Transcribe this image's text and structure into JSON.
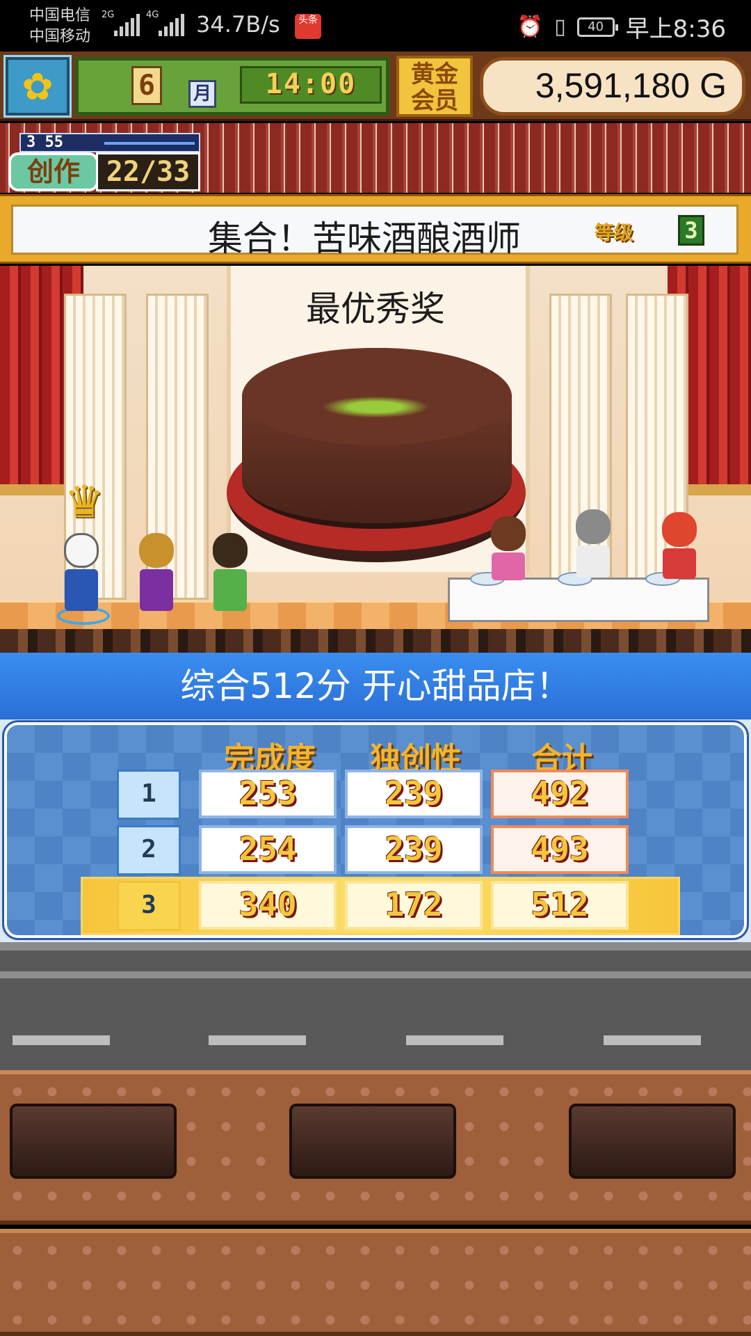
{
  "status_bar": {
    "carrier1": "中国电信",
    "carrier2": "中国移动",
    "net1": "2G",
    "net2": "4G",
    "speed": "34.7B/s",
    "app_icon": "头条",
    "battery": "40",
    "time": "早上8:36",
    "icons": [
      "alarm-icon",
      "vibrate-icon"
    ]
  },
  "hud": {
    "flower_icon": "sunflower-icon",
    "month": "6",
    "month_label": "月",
    "time": "14:00",
    "member_line1": "黄金",
    "member_line2": "会员",
    "money": "3,591,180 G"
  },
  "create": {
    "level_line": "3 55",
    "label": "创作",
    "count": "22/33"
  },
  "contest": {
    "title": "集合！苦味酒酿酒师",
    "grade_label": "等级",
    "grade": "3"
  },
  "scene": {
    "award": "最优秀奖"
  },
  "result": {
    "banner": "综合512分 开心甜品店！"
  },
  "score_table": {
    "headers": [
      "完成度",
      "独创性",
      "合计"
    ],
    "rows": [
      {
        "rank": "1",
        "completion": "253",
        "originality": "239",
        "total": "492"
      },
      {
        "rank": "2",
        "completion": "254",
        "originality": "239",
        "total": "493"
      },
      {
        "rank": "3",
        "completion": "340",
        "originality": "172",
        "total": "512"
      }
    ]
  },
  "colors": {
    "accent_blue": "#2a6ed6",
    "gold": "#f2b431",
    "highlight_row": "#f7c53a"
  }
}
